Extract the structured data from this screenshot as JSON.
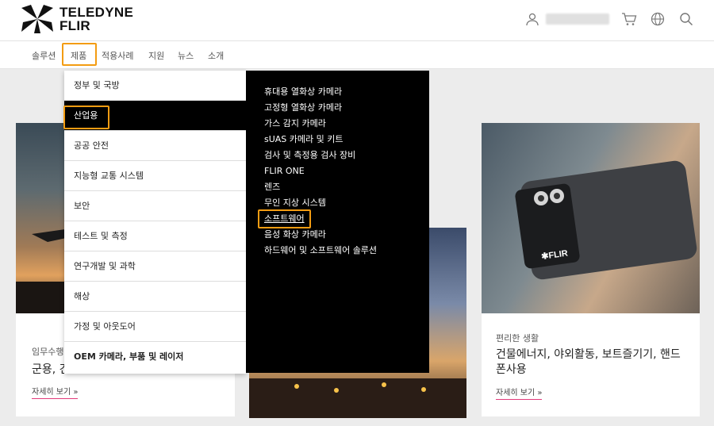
{
  "brand": {
    "line1": "TELEDYNE",
    "line2": "FLIR"
  },
  "header": {
    "icons": [
      "user-icon",
      "cart-icon",
      "globe-icon",
      "search-icon"
    ]
  },
  "nav": {
    "items": [
      "솔루션",
      "제품",
      "적용사례",
      "지원",
      "뉴스",
      "소개"
    ],
    "selected": "제품"
  },
  "menu": {
    "categories": [
      "정부 및 국방",
      "산업용",
      "공공 안전",
      "지능형 교통 시스템",
      "보안",
      "테스트 및 측정",
      "연구개발 및 과학",
      "해상",
      "가정 및 아웃도어",
      "OEM 카메라, 부품 및 레이저"
    ],
    "active_category": "산업용",
    "subitems": [
      "휴대용 열화상 카메라",
      "고정형 열화상 카메라",
      "가스 감지 카메라",
      "sUAS 카메라 및 키트",
      "검사 및 측정용 검사 장비",
      "FLIR ONE",
      "렌즈",
      "무인 지상 시스템",
      "소프트웨어",
      "음성 화상 카메라",
      "하드웨어 및 소프트웨어 솔루션"
    ],
    "highlighted_subitem": "소프트웨어"
  },
  "cards": [
    {
      "category": "임무수행",
      "title": "군용, 건",
      "more": "자세히 보기 »"
    },
    {
      "category": "편리한 생활",
      "title_line1": "건물에너지, 야외활동, 보트즐기기, 핸드",
      "title_line2": "폰사용",
      "more": "자세히 보기 »"
    }
  ],
  "colors": {
    "highlight": "#f39c12",
    "link_underline": "#e23a7a",
    "menu_dark": "#000000"
  }
}
